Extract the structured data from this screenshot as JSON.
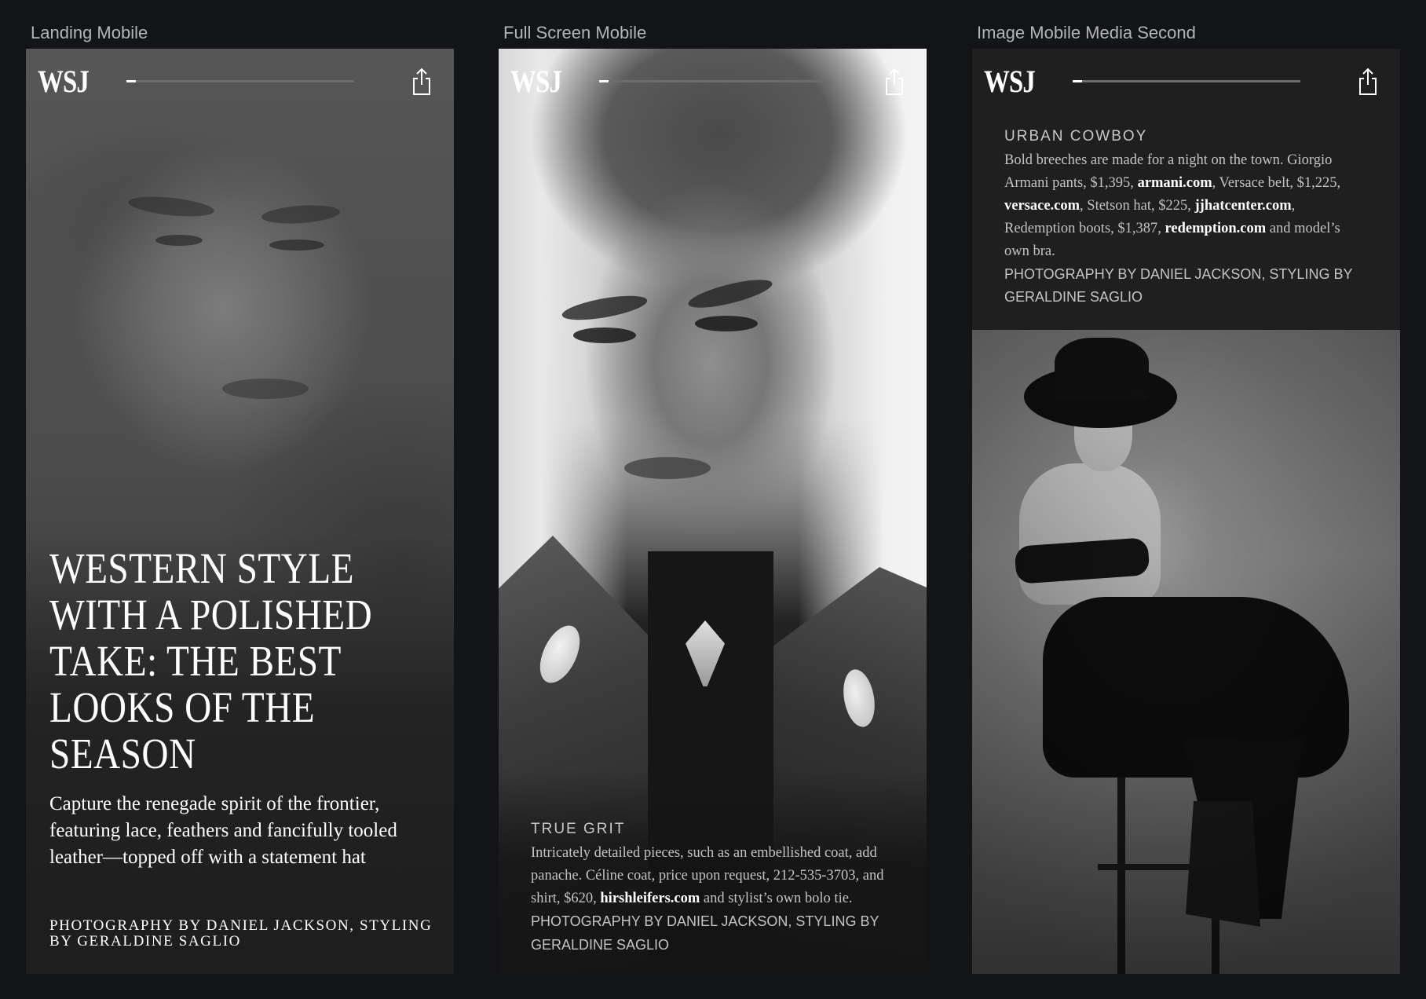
{
  "frames": [
    {
      "label": "Landing Mobile",
      "logo": "WSJ",
      "progress": 0.0,
      "headline": "WESTERN STYLE WITH A POLISHED TAKE: THE BEST LOOKS OF THE SEASON",
      "dek": "Capture the renegade spirit of the frontier, featuring lace, feathers and fancifully tooled leather—topped off with a statement hat",
      "credit": "PHOTOGRAPHY BY DANIEL JACKSON, STYLING BY GERALDINE SAGLIO"
    },
    {
      "label": "Full Screen Mobile",
      "logo": "WSJ",
      "progress": 0.0,
      "caption_head": "TRUE GRIT",
      "caption_body_1": "Intricately detailed pieces, such as an embellished coat, add panache. Céline coat, price upon request, 212-535-3703, and shirt, $620, ",
      "caption_link_1": "hirshleifers.com",
      "caption_body_2": " and stylist’s own bolo tie. ",
      "caption_credit": "PHOTOGRAPHY BY DANIEL JACKSON, STYLING BY GERALDINE SAGLIO"
    },
    {
      "label": "Image Mobile Media Second",
      "logo": "WSJ",
      "progress": 0.0,
      "caption_head": "URBAN COWBOY",
      "caption_body_1": "Bold breeches are made for a night on the town. Giorgio Armani pants, $1,395, ",
      "caption_link_1": "armani.com",
      "caption_body_2": ", Versace belt, $1,225, ",
      "caption_link_2": "versace.com",
      "caption_body_3": ", Stetson hat, $225, ",
      "caption_link_3": "jjhatcenter.com",
      "caption_body_4": ", Redemption boots, $1,387, ",
      "caption_link_4": "redemption.com",
      "caption_body_5": " and model’s own bra.",
      "caption_credit": "PHOTOGRAPHY BY DANIEL JACKSON, STYLING BY GERALDINE SAGLIO"
    }
  ],
  "colors": {
    "canvas_background": "#131417",
    "label_text": "#b3b5b9",
    "progress_track": "#6c6d70",
    "caption_text": "#c4c4c4",
    "caption_panel": "#1f1f20"
  },
  "icons": {
    "share": "share-icon"
  }
}
